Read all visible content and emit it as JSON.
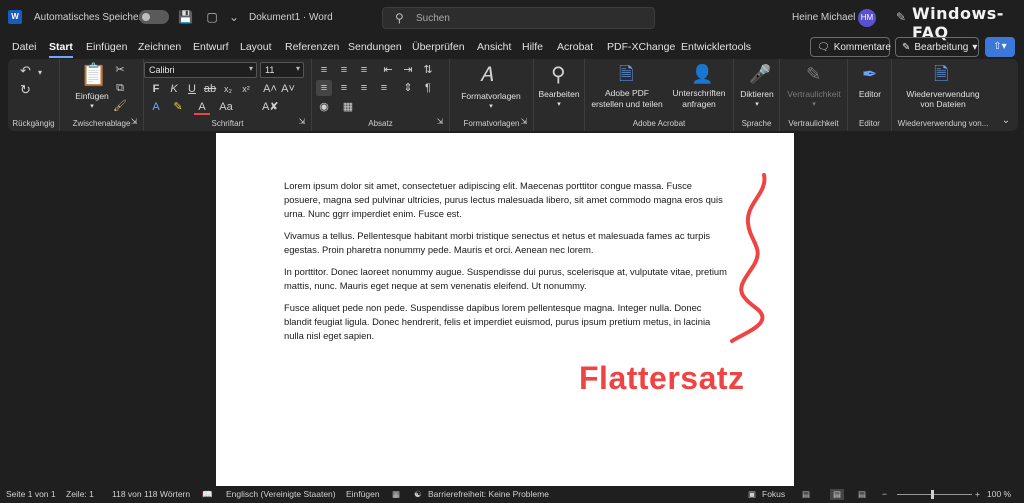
{
  "titlebar": {
    "autosave_label": "Automatisches Speichern",
    "doc_title": "Dokument1 · Word",
    "search_placeholder": "Suchen",
    "user_name": "Heine Michael",
    "user_initials": "HM",
    "brand": "Windows-FAQ",
    "app_badge": "W"
  },
  "menu": {
    "tabs": [
      "Datei",
      "Start",
      "Einfügen",
      "Zeichnen",
      "Entwurf",
      "Layout",
      "Referenzen",
      "Sendungen",
      "Überprüfen",
      "Ansicht",
      "Hilfe",
      "Acrobat",
      "PDF-XChange",
      "Entwicklertools"
    ],
    "active_tab": "Start",
    "comments_label": "Kommentare",
    "editing_label": "Bearbeitung"
  },
  "ribbon": {
    "groups": {
      "undo": "Rückgängig",
      "clipboard": "Zwischenablage",
      "font": "Schriftart",
      "paragraph": "Absatz",
      "styles": "Formatvorlagen",
      "acrobat": "Adobe Acrobat",
      "voice": "Sprache",
      "sensitivity": "Vertraulichkeit",
      "editor": "Editor",
      "reuse": "Wiederverwendung von..."
    },
    "paste_label": "Einfügen",
    "font_name": "Calibri",
    "font_size": "11",
    "styles_label": "Formatvorlagen",
    "editing_label": "Bearbeiten",
    "pdf_label_1": "Adobe PDF",
    "pdf_label_2": "erstellen und teilen",
    "sign_label_1": "Unterschriften",
    "sign_label_2": "anfragen",
    "dictate_label": "Diktieren",
    "sensitivity_label": "Vertraulichkeit",
    "editor_label": "Editor",
    "reuse_label_1": "Wiederverwendung",
    "reuse_label_2": "von Dateien"
  },
  "document": {
    "paragraphs": [
      "Lorem ipsum dolor sit amet, consectetuer adipiscing elit. Maecenas porttitor congue massa. Fusce posuere, magna sed pulvinar ultricies, purus lectus malesuada libero, sit amet commodo magna eros quis urna. Nunc ggrr imperdiet enim. Fusce est.",
      "Vivamus a tellus. Pellentesque habitant morbi tristique senectus et netus et malesuada fames ac turpis egestas. Proin pharetra nonummy pede. Mauris et orci. Aenean nec lorem.",
      "In porttitor. Donec laoreet nonummy augue. Suspendisse dui purus, scelerisque at, vulputate vitae, pretium mattis, nunc. Mauris eget neque at sem venenatis eleifend. Ut nonummy.",
      "Fusce aliquet pede non pede. Suspendisse dapibus lorem pellentesque magna. Integer nulla. Donec blandit feugiat ligula. Donec hendrerit, felis et imperdiet euismod, purus ipsum pretium metus, in lacinia nulla nisl eget sapien."
    ],
    "annotation": "Flattersatz",
    "annotation_color": "#ef4444"
  },
  "status": {
    "page": "Seite 1 von 1",
    "line": "Zeile: 1",
    "words": "118 von 118 Wörtern",
    "language": "Englisch (Vereinigte Staaten)",
    "insert_mode": "Einfügen",
    "accessibility": "Barrierefreiheit: Keine Probleme",
    "focus": "Fokus",
    "zoom": "100 %",
    "zoom_value": 100
  },
  "colors": {
    "accent": "#6ea8ff",
    "share_button": "#3b78d8",
    "avatar": "#5a4fcf",
    "word_blue": "#185abd"
  }
}
